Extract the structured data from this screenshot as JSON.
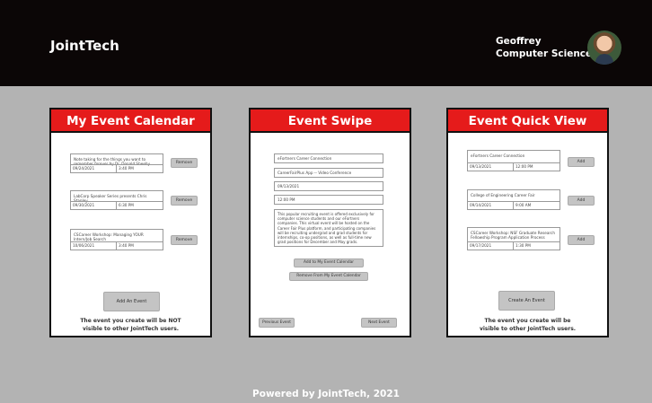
{
  "header": {
    "brand": "JointTech",
    "user_name": "Geoffrey",
    "user_dept": "Computer Science"
  },
  "calendar": {
    "title": "My Event Calendar",
    "events": [
      {
        "desc": "Note taking for the things you want to remember forever by Dr. Donald Sheehy",
        "date": "09/24/2021",
        "time": "3:40 PM",
        "button": "Remove"
      },
      {
        "desc": "LabCorp Speaker Series presents Chris Stanley",
        "date": "09/30/2021",
        "time": "6:30 PM",
        "button": "Remove"
      },
      {
        "desc": "CSCareer Workshop: Managing YOUR Intern/Job Search",
        "date": "10/06/2021",
        "time": "3:40 PM",
        "button": "Remove"
      }
    ],
    "add_button": "Add An Event",
    "note": "The event you create will be NOT visible to other JointTech users."
  },
  "swipe": {
    "title": "Event Swipe",
    "event_name": "eFortners Career Connection",
    "location": "CareerFairPlus App -- Video Conference",
    "date": "09/13/2021",
    "time": "12:00 PM",
    "description": "This popular recruiting event is offered exclusively for computer science students and our eFortners companies. This virtual event will be hosted on the Career Fair Plus platform, and participating companies will be recruiting undergrad and grad students for internships, co-op positions, as well as full-time new grad positions for December and May grads.",
    "add_button": "Add to My Event Calendar",
    "remove_button": "Remove From My Event Calendar",
    "prev_button": "Previous Event",
    "next_button": "Next Event"
  },
  "quick": {
    "title": "Event Quick View",
    "events": [
      {
        "desc": "eFortners Career Connection",
        "date": "09/13/2021",
        "time": "12:00 PM",
        "button": "Add"
      },
      {
        "desc": "College of Engineering Career Fair",
        "date": "09/14/2021",
        "time": "9:00 AM",
        "button": "Add"
      },
      {
        "desc": "CSCareer Workshop: NSF Graduate Research Fellowship Program Application Process",
        "date": "09/17/2021",
        "time": "1:30 PM",
        "button": "Add"
      }
    ],
    "add_button": "Create An Event",
    "note": "The event you create will be visible to other JointTech users."
  },
  "footer": "Powered by JointTech, 2021"
}
